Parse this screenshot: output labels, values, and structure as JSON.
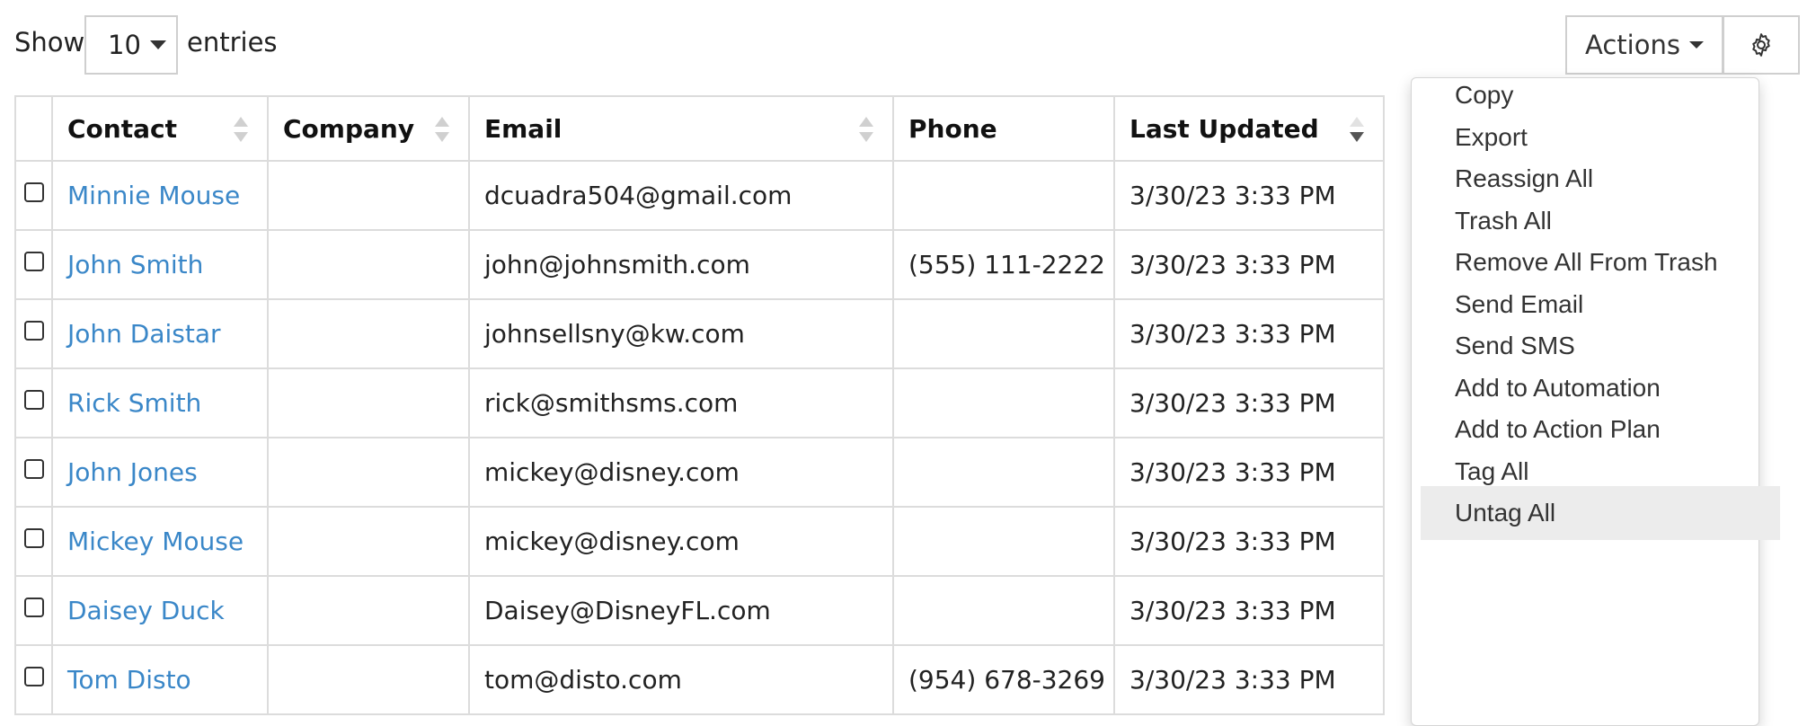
{
  "length": {
    "show_label": "Show",
    "value": "10",
    "entries_label": "entries"
  },
  "toolbar": {
    "actions_label": "Actions",
    "settings_icon": "gear-icon"
  },
  "table": {
    "headers": [
      {
        "label": "Contact",
        "sortable": true,
        "sort_state": "none"
      },
      {
        "label": "Company",
        "sortable": true,
        "sort_state": "none"
      },
      {
        "label": "Email",
        "sortable": true,
        "sort_state": "none"
      },
      {
        "label": "Phone",
        "sortable": false,
        "sort_state": "none"
      },
      {
        "label": "Last Updated",
        "sortable": true,
        "sort_state": "descending"
      }
    ],
    "rows": [
      {
        "contact": "Minnie Mouse",
        "company": "",
        "email": "dcuadra504@gmail.com",
        "phone": "",
        "updated": "3/30/23 3:33 PM"
      },
      {
        "contact": "John Smith",
        "company": "",
        "email": "john@johnsmith.com",
        "phone": "(555) 111-2222",
        "updated": "3/30/23 3:33 PM"
      },
      {
        "contact": "John Daistar",
        "company": "",
        "email": "johnsellsny@kw.com",
        "phone": "",
        "updated": "3/30/23 3:33 PM"
      },
      {
        "contact": "Rick Smith",
        "company": "",
        "email": "rick@smithsms.com",
        "phone": "",
        "updated": "3/30/23 3:33 PM"
      },
      {
        "contact": "John Jones",
        "company": "",
        "email": "mickey@disney.com",
        "phone": "",
        "updated": "3/30/23 3:33 PM"
      },
      {
        "contact": "Mickey Mouse",
        "company": "",
        "email": "mickey@disney.com",
        "phone": "",
        "updated": "3/30/23 3:33 PM"
      },
      {
        "contact": "Daisey Duck",
        "company": "",
        "email": "Daisey@DisneyFL.com",
        "phone": "",
        "updated": "3/30/23 3:33 PM"
      },
      {
        "contact": "Tom Disto",
        "company": "",
        "email": "tom@disto.com",
        "phone": "(954) 678-3269",
        "updated": "3/30/23 3:33 PM"
      }
    ]
  },
  "actions_menu": {
    "items": [
      {
        "label": "Copy",
        "active": false
      },
      {
        "label": "Export",
        "active": false
      },
      {
        "label": "Reassign All",
        "active": false
      },
      {
        "label": "Trash All",
        "active": false
      },
      {
        "label": "Remove All From Trash",
        "active": false
      },
      {
        "label": "Send Email",
        "active": false
      },
      {
        "label": "Send SMS",
        "active": false
      },
      {
        "label": "Add to Automation",
        "active": false
      },
      {
        "label": "Add to Action Plan",
        "active": false
      },
      {
        "label": "Tag All",
        "active": false
      },
      {
        "label": "Untag All",
        "active": true
      }
    ]
  },
  "colors": {
    "link": "#3a87c8",
    "border": "#dcdcdc",
    "hover": "#ececec"
  }
}
